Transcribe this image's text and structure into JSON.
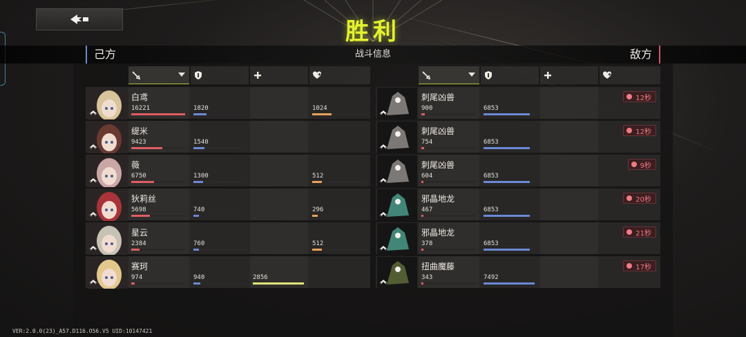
{
  "title": "胜利",
  "info_bar": {
    "left_label": "己方",
    "center_label": "战斗信息",
    "right_label": "敌方"
  },
  "columns": [
    {
      "key": "damage",
      "icon": "sword-icon",
      "sortable": true
    },
    {
      "key": "defense",
      "icon": "shield-icon"
    },
    {
      "key": "support",
      "icon": "plus-icon"
    },
    {
      "key": "heal",
      "icon": "heart-plus-icon"
    }
  ],
  "allies": [
    {
      "name": "白鸢",
      "damage": "16221",
      "damage_ratio": 1.0,
      "defense": "1820",
      "defense_ratio": 0.26,
      "heal": "1024",
      "heal_ratio": 0.36,
      "avatar_color": "#d8c49a",
      "class_icon": "wing-icon"
    },
    {
      "name": "缇米",
      "damage": "9423",
      "damage_ratio": 0.58,
      "defense": "1540",
      "defense_ratio": 0.22,
      "avatar_color": "#6a3a30",
      "class_icon": "wing-icon"
    },
    {
      "name": "薇",
      "damage": "6750",
      "damage_ratio": 0.42,
      "defense": "1300",
      "defense_ratio": 0.19,
      "heal": "512",
      "heal_ratio": 0.18,
      "avatar_color": "#c9a7a6",
      "class_icon": "wing-icon"
    },
    {
      "name": "狄莉丝",
      "damage": "5698",
      "damage_ratio": 0.35,
      "defense": "740",
      "defense_ratio": 0.11,
      "heal": "296",
      "heal_ratio": 0.1,
      "avatar_color": "#a8343a",
      "class_icon": "wing-icon"
    },
    {
      "name": "星云",
      "damage": "2384",
      "damage_ratio": 0.15,
      "defense": "760",
      "defense_ratio": 0.11,
      "heal": "512",
      "heal_ratio": 0.18,
      "avatar_color": "#c8c2b4",
      "class_icon": "wing-icon"
    },
    {
      "name": "赛珂",
      "damage": "974",
      "damage_ratio": 0.06,
      "defense": "940",
      "defense_ratio": 0.13,
      "support": "2856",
      "support_ratio": 1.0,
      "avatar_color": "#e3c88e",
      "class_icon": "wing-icon"
    }
  ],
  "enemies": [
    {
      "name": "刺尾凶兽",
      "damage": "900",
      "damage_ratio": 0.06,
      "defense": "6853",
      "defense_ratio": 0.91,
      "timer": "12秒",
      "avatar_color": "#8e8a86",
      "class_icon": "wing-icon"
    },
    {
      "name": "刺尾凶兽",
      "damage": "754",
      "damage_ratio": 0.05,
      "defense": "6853",
      "defense_ratio": 0.91,
      "timer": "12秒",
      "avatar_color": "#8e8a86",
      "class_icon": "wing-icon"
    },
    {
      "name": "刺尾凶兽",
      "damage": "604",
      "damage_ratio": 0.04,
      "defense": "6853",
      "defense_ratio": 0.91,
      "timer": "9秒",
      "avatar_color": "#8e8a86",
      "class_icon": "wing-icon"
    },
    {
      "name": "邪晶地龙",
      "damage": "467",
      "damage_ratio": 0.03,
      "defense": "6853",
      "defense_ratio": 0.91,
      "timer": "20秒",
      "avatar_color": "#4a9a88",
      "class_icon": "wing-icon"
    },
    {
      "name": "邪晶地龙",
      "damage": "378",
      "damage_ratio": 0.025,
      "defense": "6853",
      "defense_ratio": 0.91,
      "timer": "21秒",
      "avatar_color": "#4a9a88",
      "class_icon": "wing-icon"
    },
    {
      "name": "扭曲魔藤",
      "damage": "343",
      "damage_ratio": 0.022,
      "defense": "7492",
      "defense_ratio": 1.0,
      "timer": "17秒",
      "avatar_color": "#5e6a3a",
      "class_icon": "wing-icon"
    }
  ],
  "footer": {
    "version": "VER:2.0.0(23)_A57.D116.O56.V5    UID:10147421"
  },
  "colors": {
    "title": "#e4f230",
    "damage": "#e05d63",
    "defense": "#6c89d6",
    "heal": "#e9a25b",
    "support": "#e3e57b",
    "timer": "#f07b84"
  }
}
